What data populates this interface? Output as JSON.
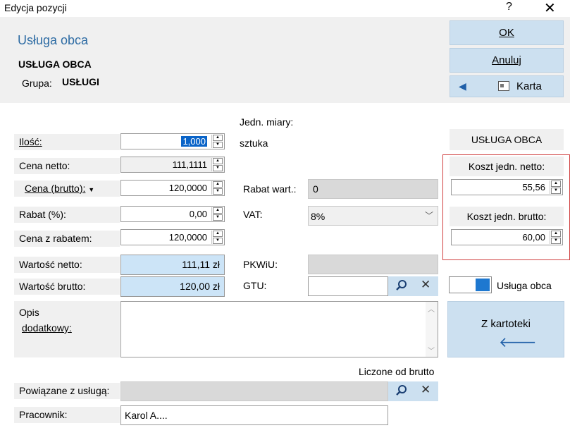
{
  "window": {
    "title": "Edycja pozycji",
    "help": "?",
    "close": "✕"
  },
  "header": {
    "title": "Usługa obca",
    "name": "USŁUGA OBCA",
    "group_label": "Grupa:",
    "group_value": "USŁUGI"
  },
  "buttons": {
    "ok": "OK",
    "cancel": "Anuluj",
    "card": "Karta",
    "from_catalog": "Z kartoteki"
  },
  "form": {
    "unit_label": "Jedn. miary:",
    "unit_value": "sztuka",
    "quantity_label": "Ilość:",
    "quantity_value": "1,000",
    "net_price_label": "Cena netto:",
    "net_price_value": "111,1111",
    "gross_price_label": "Cena (brutto):",
    "gross_price_value": "120,0000",
    "discount_value_label": "Rabat wart.:",
    "discount_value_value": "0",
    "discount_pct_label": "Rabat (%):",
    "discount_pct_value": "0,00",
    "vat_label": "VAT:",
    "vat_value": "8%",
    "price_after_discount_label": "Cena z rabatem:",
    "price_after_discount_value": "120,0000",
    "net_value_label": "Wartość netto:",
    "net_value_value": "111,11 zł",
    "pkwiu_label": "PKWiU:",
    "pkwiu_value": "",
    "gross_value_label": "Wartość brutto:",
    "gross_value_value": "120,00 zł",
    "gtu_label": "GTU:",
    "gtu_value": "",
    "description_label_1": "Opis",
    "description_label_2": "dodatkowy:",
    "description_value": "",
    "calc_note": "Liczone od brutto",
    "linked_service_label": "Powiązane z usługą:",
    "linked_service_value": "",
    "employee_label": "Pracownik:",
    "employee_value": "Karol A...."
  },
  "cost": {
    "heading": "USŁUGA OBCA",
    "net_unit_cost_label": "Koszt jedn. netto:",
    "net_unit_cost_value": "55,56",
    "gross_unit_cost_label": "Koszt jedn. brutto:",
    "gross_unit_cost_value": "60,00",
    "toggle_label": "Usługa obca",
    "toggle_on": true,
    "highlight_color": "#d04040"
  },
  "colors": {
    "accent_blue": "#2e6ca4",
    "button_bg": "#cce0f0",
    "value_bg": "#cce4f7"
  }
}
